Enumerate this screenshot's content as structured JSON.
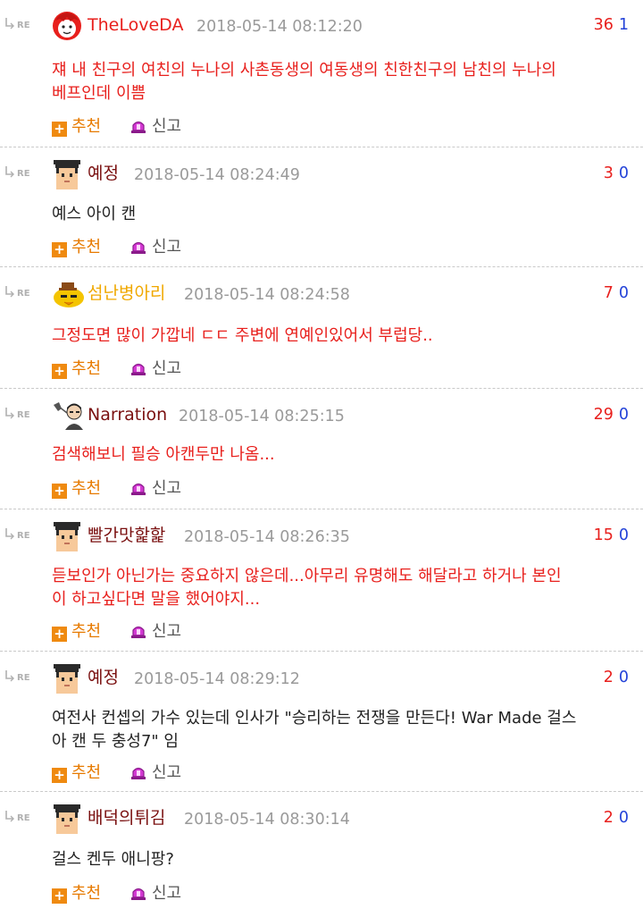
{
  "comments": [
    {
      "nick": "TheLoveDA",
      "nick_color": "#e8201d",
      "avatar": "red-face-icon",
      "date": "2018-05-14 08:12:20",
      "up": "36",
      "down": "1",
      "body": "쟤 내 친구의 여친의 누나의 사촌동생의 여동생의 친한친구의 남친의 누나의\n베프인데 이쁨",
      "body_color": "red",
      "recommend": "추천",
      "report": "신고"
    },
    {
      "nick": "예정",
      "nick_color": "#7a1010",
      "avatar": "pixel-boy-icon",
      "date": "2018-05-14 08:24:49",
      "up": "3",
      "down": "0",
      "body": "예스 아이 캔",
      "body_color": "black",
      "recommend": "추천",
      "report": "신고"
    },
    {
      "nick": "섬난병아리",
      "nick_color": "#f0a800",
      "avatar": "chick-icon",
      "date": "2018-05-14 08:24:58",
      "up": "7",
      "down": "0",
      "body": "그정도면 많이 가깝네 ㄷㄷ 주변에 연예인있어서 부럽당..",
      "body_color": "red",
      "recommend": "추천",
      "report": "신고"
    },
    {
      "nick": "Narration",
      "nick_color": "#7a1010",
      "avatar": "narrator-icon",
      "date": "2018-05-14 08:25:15",
      "up": "29",
      "down": "0",
      "body": "검색해보니 필승 아캔두만 나옴...",
      "body_color": "red",
      "recommend": "추천",
      "report": "신고"
    },
    {
      "nick": "빨간맛핥핥",
      "nick_color": "#7a1010",
      "avatar": "pixel-boy-icon",
      "date": "2018-05-14 08:26:35",
      "up": "15",
      "down": "0",
      "body": "듣보인가 아닌가는 중요하지 않은데...아무리 유명해도 해달라고 하거나 본인\n이 하고싶다면 말을 했어야지...",
      "body_color": "red",
      "recommend": "추천",
      "report": "신고"
    },
    {
      "nick": "예정",
      "nick_color": "#7a1010",
      "avatar": "pixel-boy-icon",
      "date": "2018-05-14 08:29:12",
      "up": "2",
      "down": "0",
      "body": "여전사 컨셉의 가수 있는데 인사가 \"승리하는 전쟁을 만든다! War Made 걸스\n아 캔 두 충성7\" 임",
      "body_color": "black",
      "recommend": "추천",
      "report": "신고"
    },
    {
      "nick": "배덕의튀김",
      "nick_color": "#7a1010",
      "avatar": "pixel-boy-icon",
      "date": "2018-05-14 08:30:14",
      "up": "2",
      "down": "0",
      "body": "걸스 켄두 애니팡?",
      "body_color": "black",
      "recommend": "추천",
      "report": "신고"
    }
  ],
  "colors": {
    "upvote": "#e8201d",
    "downvote": "#2342d8",
    "date": "#9a9a9a",
    "recommend": "#e77a00"
  }
}
